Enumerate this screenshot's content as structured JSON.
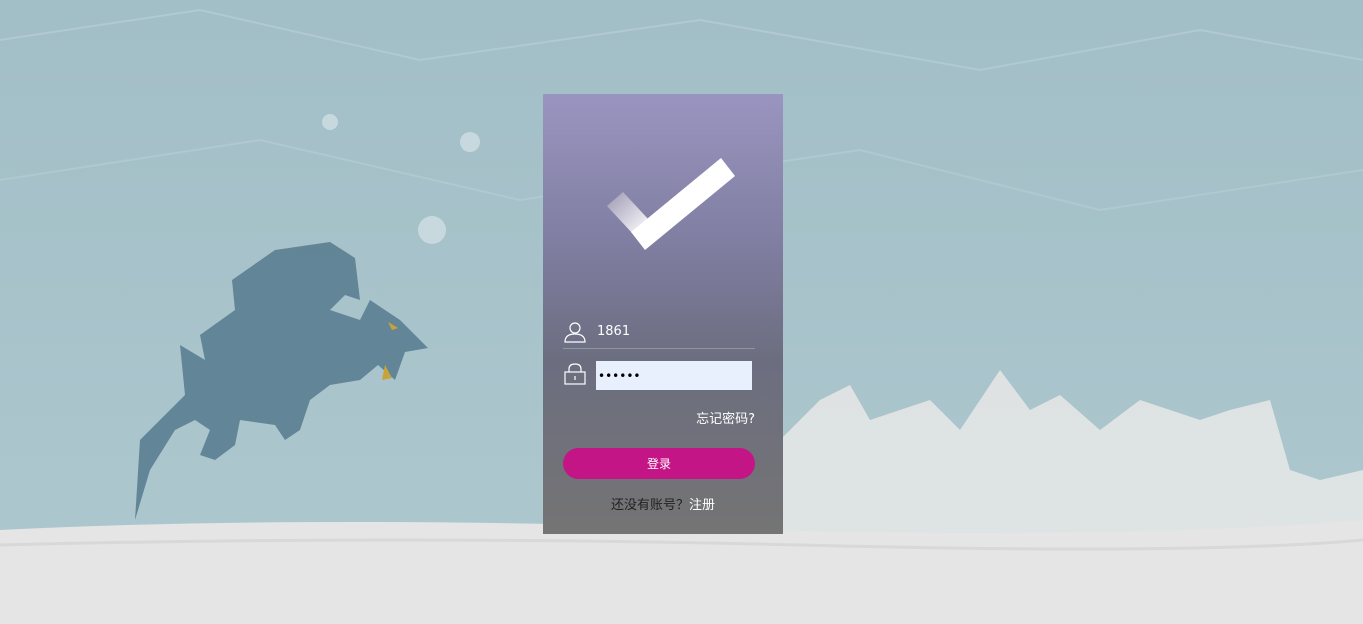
{
  "login": {
    "username_value": "1861",
    "password_value": "••••••",
    "forgot_label": "忘记密码?",
    "login_label": "登录",
    "no_account_label": "还没有账号？",
    "register_label": "注册"
  },
  "icons": {
    "logo": "checkmark-icon",
    "user": "user-icon",
    "password": "lock-icon"
  },
  "colors": {
    "accent": "#c41586",
    "card_top": "#9a95c0",
    "card_bottom": "#747474",
    "input_bg": "#e8f0fe"
  }
}
